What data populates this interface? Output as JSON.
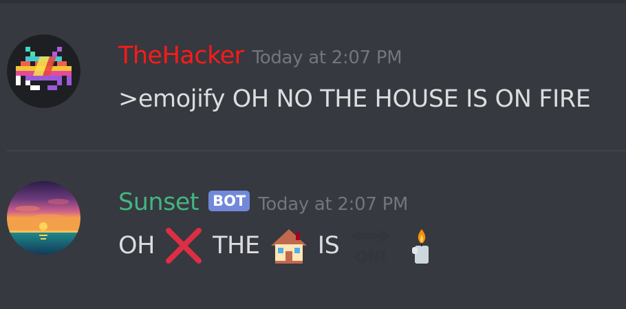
{
  "messages": [
    {
      "username": "TheHacker",
      "username_color": "#ff1a1a",
      "timestamp": "Today at 2:07 PM",
      "content": ">emojify OH NO THE HOUSE IS ON FIRE",
      "avatar": "space-invader-icon"
    },
    {
      "username": "Sunset",
      "username_color": "#43b581",
      "badge": "BOT",
      "timestamp": "Today at 2:07 PM",
      "content_words": [
        "OH",
        "THE",
        "IS"
      ],
      "emojis": [
        "cross-mark-icon",
        "house-icon",
        "on-arrow-icon",
        "candle-icon"
      ],
      "on_arrow_label": "ON!",
      "avatar": "sunset-icon"
    }
  ],
  "colors": {
    "background": "#36393f",
    "text": "#dcddde",
    "timestamp": "#72767d",
    "bot_badge": "#7289da"
  }
}
